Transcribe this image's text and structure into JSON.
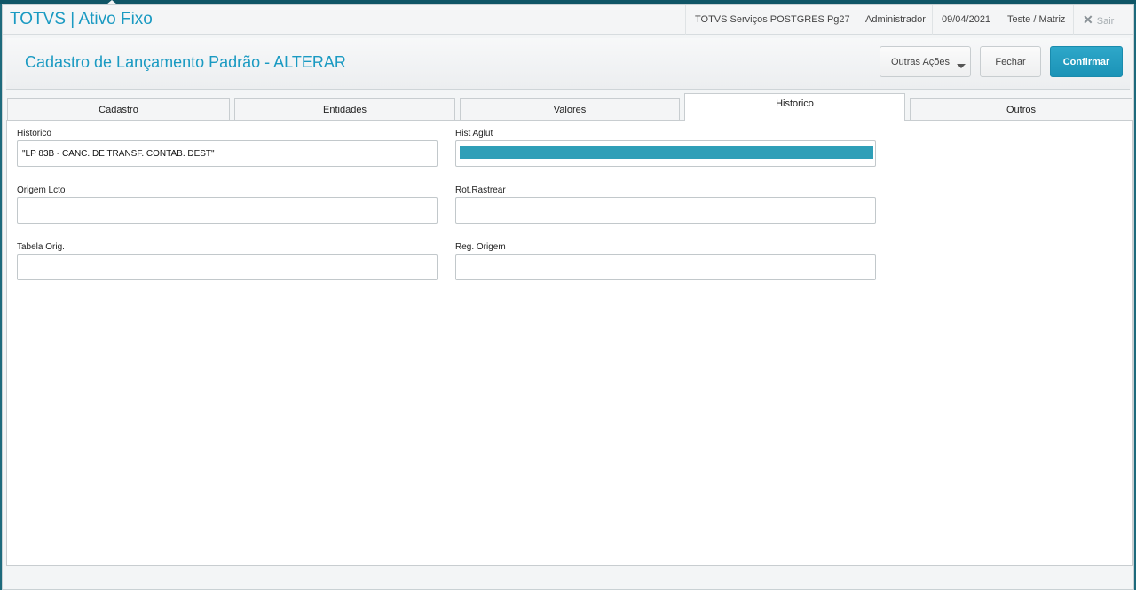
{
  "header": {
    "app_title": "TOTVS | Ativo Fixo",
    "environment": "TOTVS Serviços POSTGRES Pg27",
    "user": "Administrador",
    "date": "09/04/2021",
    "branch": "Teste / Matriz",
    "exit_label": "Sair",
    "exit_icon": "close-x-icon"
  },
  "toolbar": {
    "page_title": "Cadastro de Lançamento Padrão - ALTERAR",
    "other_actions_label": "Outras Ações",
    "close_label": "Fechar",
    "confirm_label": "Confirmar",
    "confirm_color": "#1b93b7"
  },
  "tabs": [
    {
      "label": "Cadastro",
      "active": false
    },
    {
      "label": "Entidades",
      "active": false
    },
    {
      "label": "Valores",
      "active": false
    },
    {
      "label": "Historico",
      "active": true
    },
    {
      "label": "Outros",
      "active": false
    }
  ],
  "form": {
    "historico": {
      "label": "Historico",
      "value": "\"LP 83B - CANC. DE TRANSF. CONTAB. DEST\""
    },
    "hist_aglut": {
      "label": "Hist Aglut",
      "value": ""
    },
    "origem_lcto": {
      "label": "Origem Lcto",
      "value": ""
    },
    "rot_rastrear": {
      "label": "Rot.Rastrear",
      "value": ""
    },
    "tabela_orig": {
      "label": "Tabela Orig.",
      "value": ""
    },
    "reg_origem": {
      "label": "Reg. Origem",
      "value": ""
    }
  }
}
